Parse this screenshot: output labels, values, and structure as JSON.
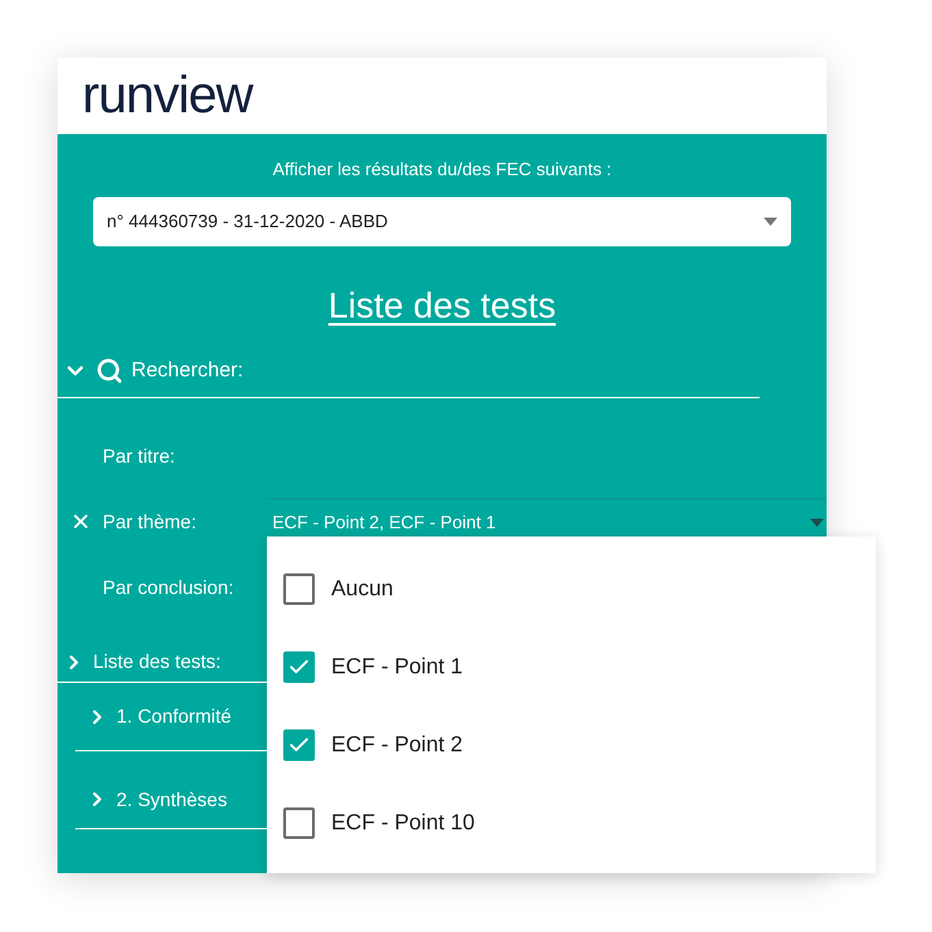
{
  "logo": "runview",
  "fec_label": "Afficher les résultats du/des FEC suivants :",
  "fec_select": {
    "value": "n° 444360739 - 31-12-2020 - ABBD"
  },
  "title": "Liste des tests",
  "search": {
    "label": "Rechercher:",
    "expanded": true
  },
  "filters": [
    {
      "label": "Par titre:",
      "clearable": false
    },
    {
      "label": "Par thème:",
      "clearable": true,
      "value": "ECF - Point 2, ECF - Point 1"
    },
    {
      "label": "Par conclusion:",
      "clearable": false
    }
  ],
  "tests_section": {
    "label": "Liste des tests:",
    "expanded": false
  },
  "test_groups": [
    {
      "label": "1. Conformité",
      "expanded": false
    },
    {
      "label": "2. Synthèses",
      "expanded": false
    }
  ],
  "theme_options": [
    {
      "label": "Aucun",
      "checked": false
    },
    {
      "label": "ECF - Point 1",
      "checked": true
    },
    {
      "label": "ECF - Point 2",
      "checked": true
    },
    {
      "label": "ECF - Point 10",
      "checked": false
    }
  ]
}
